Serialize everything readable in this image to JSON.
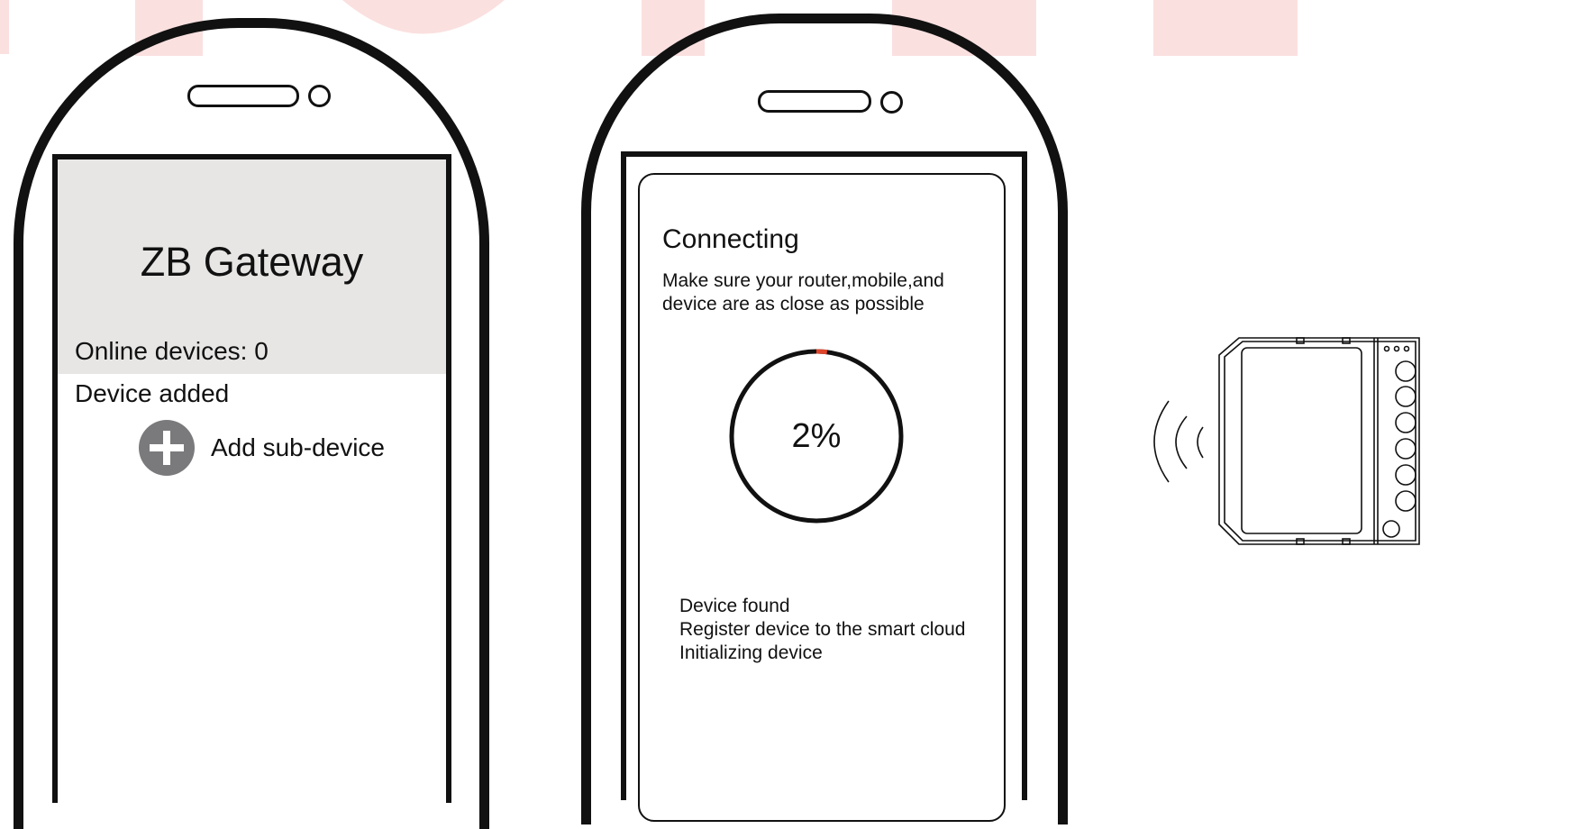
{
  "colors": {
    "watermark": "#fbe0e0",
    "outline": "#111111",
    "header_bg": "#e7e6e5",
    "add_button": "#7a7a7c",
    "progress_accent": "#e0452b"
  },
  "gateway_screen": {
    "title": "ZB Gateway",
    "online_devices": "Online devices: 0",
    "device_added": "Device added",
    "add_sub_device_label": "Add sub-device",
    "add_icon": "plus-circle-icon"
  },
  "connecting_screen": {
    "title": "Connecting",
    "message": "Make sure your router,mobile,and device are as close as possible",
    "progress_fraction": 0.02,
    "progress_text": "2%",
    "steps": [
      "Device found",
      "Register device to the smart cloud",
      "Initializing device"
    ]
  },
  "device_illustration": {
    "icon": "gateway-device-icon",
    "signal_icon": "wireless-signal-icon"
  }
}
